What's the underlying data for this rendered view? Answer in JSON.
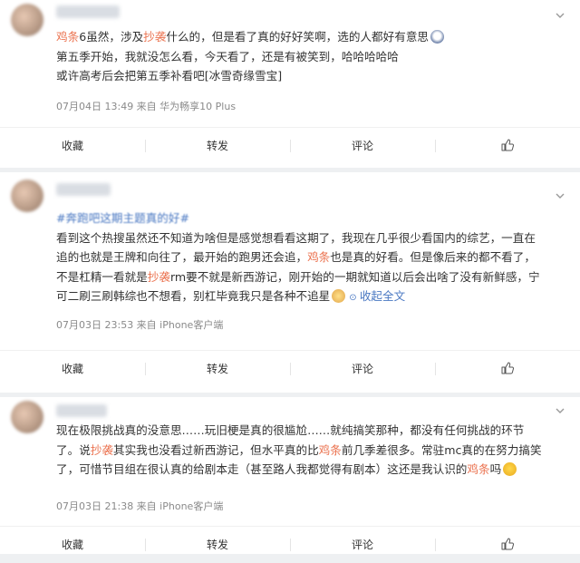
{
  "posts": [
    {
      "username_blurred": "",
      "lines": [
        [
          {
            "t": "鸡条",
            "hl": true
          },
          {
            "t": "6虽然，涉及"
          },
          {
            "t": "抄袭",
            "hl": true
          },
          {
            "t": "什么的，但是看了真的好好笑啊，选的人都好有意思"
          }
        ],
        [
          {
            "t": "第五季开始，我就没怎么看，今天看了，还是有被笑到，哈哈哈哈哈"
          }
        ],
        [
          {
            "t": "或许高考后会把第五季补看吧[冰雪奇缘雪宝]"
          }
        ]
      ],
      "meta": "07月04日 13:49  来自 华为畅享10 Plus"
    },
    {
      "tag": "#奔跑吧这期主题真的好#",
      "lines": [
        [
          {
            "t": "看到这个热搜虽然还不知道为啥但是感觉想看看这期了，我现在几乎很少看国内的综艺，一直在"
          }
        ],
        [
          {
            "t": "追的也就是王牌和向往了，最开始的跑男还会追，"
          },
          {
            "t": "鸡条",
            "hl": true
          },
          {
            "t": "也是真的好看。但是像后来的都不看了，"
          }
        ],
        [
          {
            "t": "不是杠精一看就是"
          },
          {
            "t": "抄袭",
            "hl": true
          },
          {
            "t": "rm要不就是新西游记，刚开始的一期就知道以后会出啥了没有新鲜感，宁"
          }
        ],
        [
          {
            "t": "可二刷三刷韩综也不想看，别杠毕竟我只是各种不追星"
          }
        ]
      ],
      "collapse_label": "收起全文",
      "meta": "07月03日 23:53  来自 iPhone客户端"
    },
    {
      "lines": [
        [
          {
            "t": "现在极限挑战真的没意思……玩旧梗是真的很尴尬……就纯搞笑那种，都没有任何挑战的环节"
          }
        ],
        [
          {
            "t": "了。说"
          },
          {
            "t": "抄袭",
            "hl": true
          },
          {
            "t": "其实我也没看过新西游记，但水平真的比"
          },
          {
            "t": "鸡条",
            "hl": true
          },
          {
            "t": "前几季差很多。常驻mc真的在努力搞笑"
          }
        ],
        [
          {
            "t": "了，可惜节目组在很认真的给剧本走（甚至路人我都觉得有剧本）这还是我认识的"
          },
          {
            "t": "鸡条",
            "hl": true
          },
          {
            "t": "吗"
          }
        ]
      ],
      "meta": "07月03日 21:38  来自 iPhone客户端"
    }
  ],
  "actions": {
    "favorite": "收藏",
    "repost": "转发",
    "comment": "评论"
  },
  "icons": {
    "more": "chevron-down-icon",
    "like": "thumbs-up-icon"
  },
  "colors": {
    "highlight": "#eb7350",
    "link": "#4a78c2"
  }
}
